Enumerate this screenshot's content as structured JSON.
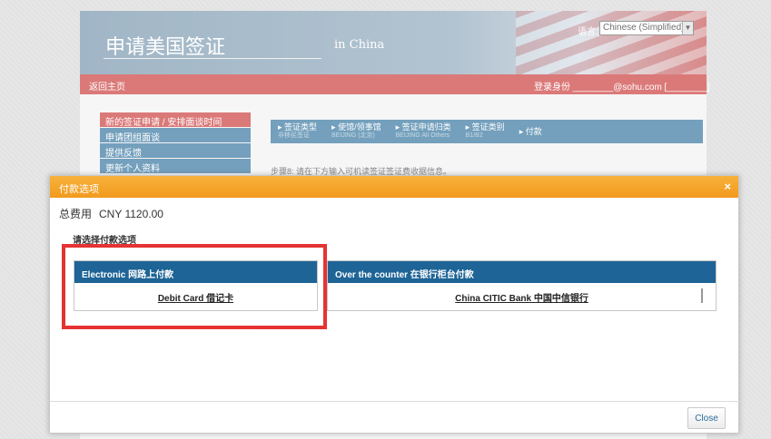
{
  "background": {
    "title": "申请美国签证",
    "subtitle": "in China",
    "language_label": "语言:",
    "language_value": "Chinese (Simplified)",
    "home_link": "返回主页",
    "login_text": "登录身份 ________@sohu.com [________]",
    "sidebar": [
      "新的签证申请 / 安排面谈时间",
      "申请团组面谈",
      "提供反馈",
      "更新个人资料"
    ],
    "steps": [
      {
        "label": "签证类型",
        "sub": "非移民签证"
      },
      {
        "label": "使馆/领事馆",
        "sub": "BEIJING (北京)"
      },
      {
        "label": "签证申请归类",
        "sub": "BEIJING All Others"
      },
      {
        "label": "签证类别",
        "sub": "B1/B2"
      },
      {
        "label": "付款",
        "sub": ""
      }
    ],
    "step_note": "步骤8: 请在下方输入可机读签证签证费收据信息。"
  },
  "dialog": {
    "title": "付款选项",
    "close_x": "×",
    "total_label": "总费用",
    "total_value": "CNY 1120.00",
    "select_label": "请选择付款选项",
    "electronic_header": "Electronic 网路上付款",
    "electronic_option": "Debit Card 借记卡",
    "counter_header": "Over the counter 在银行柜台付款",
    "counter_option": "China CITIC Bank 中国中信银行",
    "close_button": "Close"
  },
  "colors": {
    "dialog_title_bar": "#f29a1e",
    "option_header": "#1e6496",
    "highlight_border": "#e53333",
    "nav_red": "#c83232"
  }
}
